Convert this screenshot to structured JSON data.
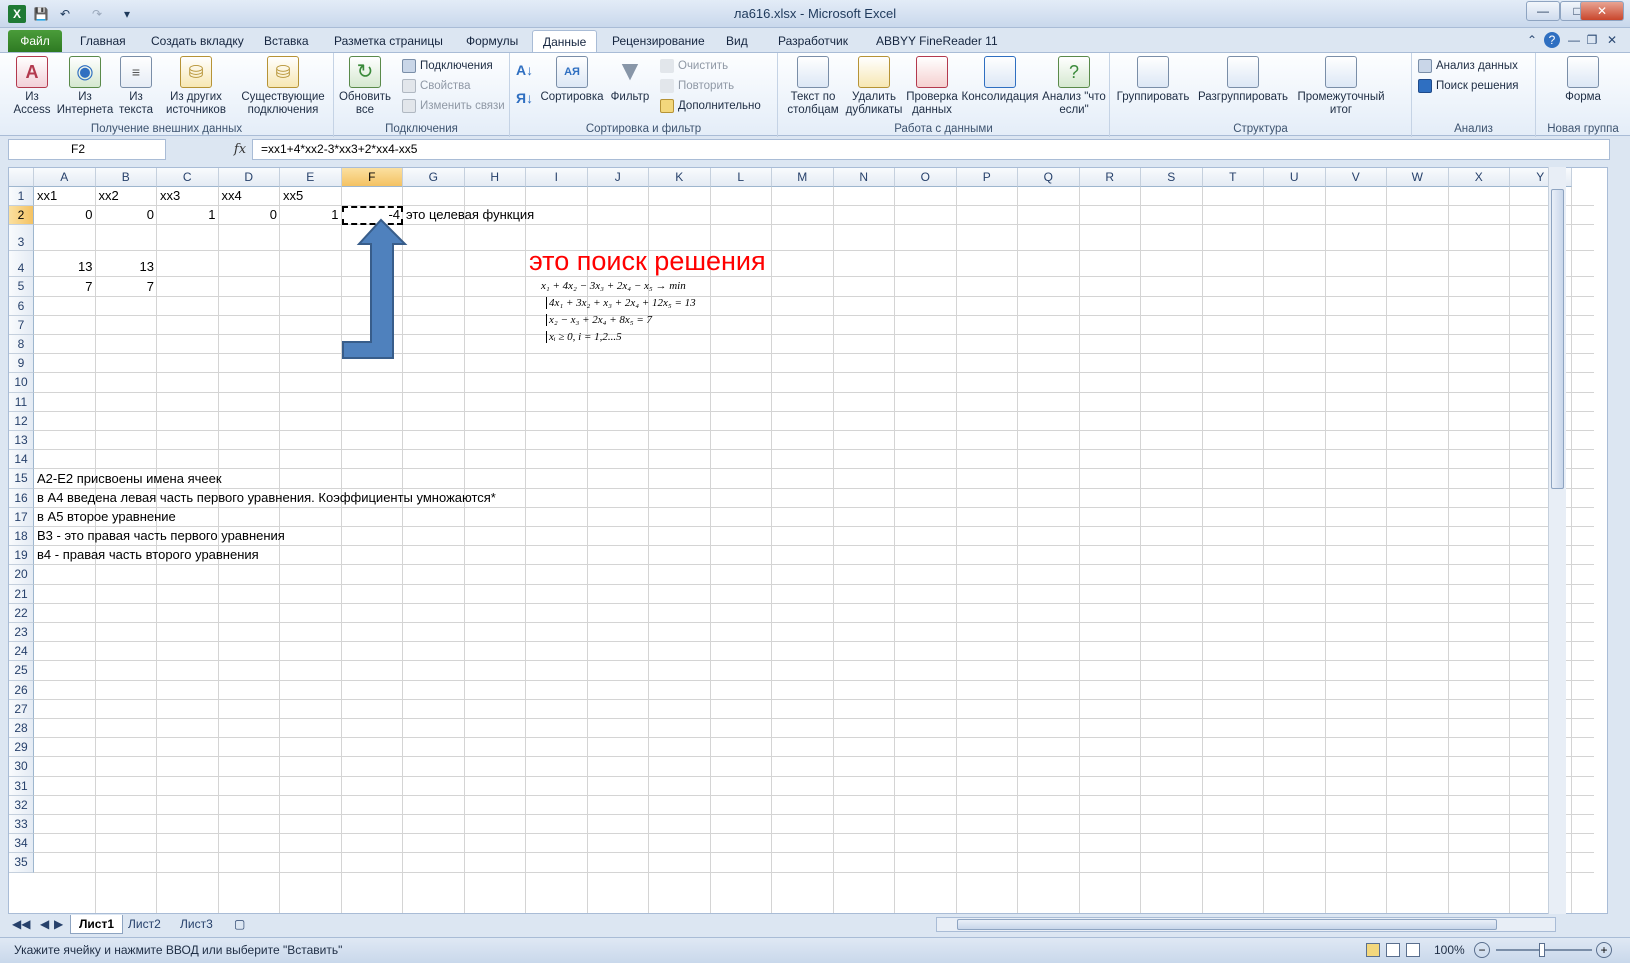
{
  "window": {
    "title": "ла616.xlsx - Microsoft Excel"
  },
  "tabs": [
    "Файл",
    "Главная",
    "Создать вкладку",
    "Вставка",
    "Разметка страницы",
    "Формулы",
    "Данные",
    "Рецензирование",
    "Вид",
    "Разработчик",
    "ABBYY FineReader 11"
  ],
  "active_tab": "Данные",
  "ribbon": {
    "g1": {
      "label": "Получение внешних данных",
      "b1": "Из Access",
      "b2": "Из Интернета",
      "b3": "Из текста",
      "b4": "Из других источников",
      "b5": "Существующие подключения"
    },
    "g2": {
      "label": "Подключения",
      "refresh": "Обновить все",
      "s1": "Подключения",
      "s2": "Свойства",
      "s3": "Изменить связи"
    },
    "g3": {
      "label": "Сортировка и фильтр",
      "sort": "Сортировка",
      "filter": "Фильтр",
      "s1": "Очистить",
      "s2": "Повторить",
      "s3": "Дополнительно"
    },
    "g4": {
      "label": "Работа с данными",
      "b1": "Текст по столбцам",
      "b2": "Удалить дубликаты",
      "b3": "Проверка данных",
      "b4": "Консолидация",
      "b5": "Анализ \"что если\""
    },
    "g5": {
      "label": "Структура",
      "b1": "Группировать",
      "b2": "Разгруппировать",
      "b3": "Промежуточный итог"
    },
    "g6": {
      "label": "Анализ",
      "s1": "Анализ данных",
      "s2": "Поиск решения"
    },
    "g7": {
      "label": "Новая группа",
      "b1": "Форма"
    }
  },
  "formula_bar": {
    "name_box": "F2",
    "fx": "fx",
    "formula": "=xx1+4*xx2-3*xx3+2*xx4-xx5"
  },
  "columns": [
    "A",
    "B",
    "C",
    "D",
    "E",
    "F",
    "G",
    "H",
    "I",
    "J",
    "K",
    "L",
    "M",
    "N",
    "O",
    "P",
    "Q",
    "R",
    "S",
    "T",
    "U",
    "V",
    "W",
    "X",
    "Y"
  ],
  "rows": [
    "1",
    "2",
    "3",
    "4",
    "5",
    "6",
    "7",
    "8",
    "9",
    "10",
    "11",
    "12",
    "13",
    "14",
    "15",
    "16",
    "17",
    "18",
    "19",
    "20",
    "21",
    "22",
    "23",
    "24",
    "25",
    "26",
    "27",
    "28",
    "29",
    "30",
    "31",
    "32",
    "33",
    "34",
    "35"
  ],
  "cells": {
    "A1": "xx1",
    "B1": "xx2",
    "C1": "xx3",
    "D1": "xx4",
    "E1": "xx5",
    "A2": "0",
    "B2": "0",
    "C2": "1",
    "D2": "0",
    "E2": "1",
    "F2": "-4",
    "G2": "это целевая функция",
    "A4": "13",
    "B4": "13",
    "A5": "7",
    "B5": "7",
    "A15": "A2-E2 присвоены имена ячеек",
    "A16": "в А4 введена левая часть первого уравнения. Коэффициенты умножаются*",
    "A17": "в А5 второе уравнение",
    "A18": "В3  - это правая часть первого уравнения",
    "A19": "в4 - правая часть второго уравнения"
  },
  "annotation": {
    "text": "это поиск решения",
    "color": "#ff0000"
  },
  "equations": {
    "e1": "x₁ + 4x₂ − 3x₃ + 2x₄ − x₅ → min",
    "e2": "4x₁ + 3x₂ + x₃ + 2x₄ + 12x₅ = 13",
    "e3": "x₂ − x₃ + 2x₄ + 8x₅ = 7",
    "e4": "xᵢ ≥ 0, i = 1,2...5"
  },
  "sheets": [
    "Лист1",
    "Лист2",
    "Лист3"
  ],
  "active_sheet": "Лист1",
  "status": {
    "text": "Укажите ячейку и нажмите ВВОД или выберите \"Вставить\"",
    "zoom": "100%"
  }
}
